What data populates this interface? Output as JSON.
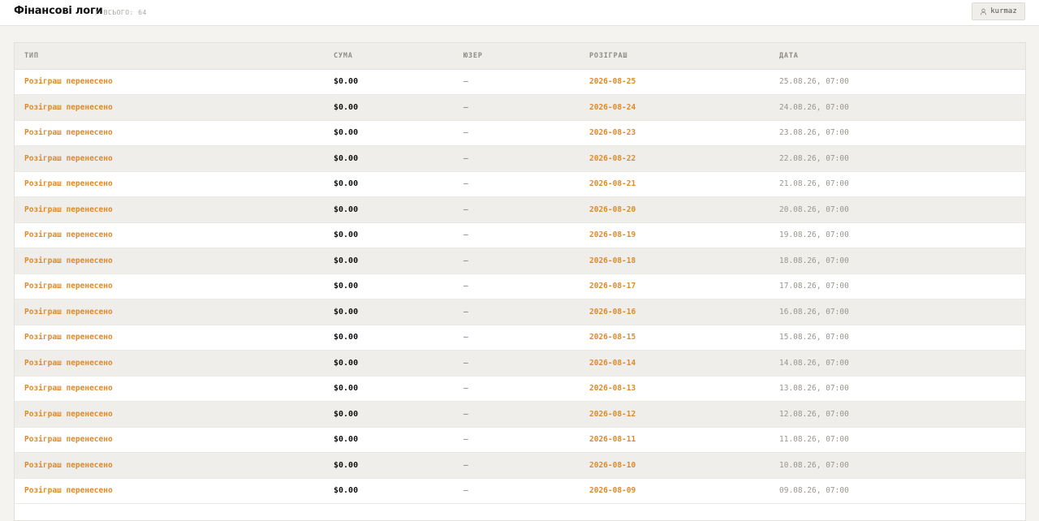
{
  "header": {
    "title": "Фінансові логи",
    "count_label": "/ ВСЬОГО: 64",
    "user_name": "kurmaz",
    "user_icon": "user-icon"
  },
  "table": {
    "columns": [
      "ТИП",
      "СУМА",
      "ЮЗЕР",
      "РОЗІГРАШ",
      "ДАТА"
    ],
    "rows": [
      {
        "type": "Розіграш перенесено",
        "amount": "$0.00",
        "user": "—",
        "draw": "2026-08-25",
        "date": "25.08.26, 07:00"
      },
      {
        "type": "Розіграш перенесено",
        "amount": "$0.00",
        "user": "—",
        "draw": "2026-08-24",
        "date": "24.08.26, 07:00"
      },
      {
        "type": "Розіграш перенесено",
        "amount": "$0.00",
        "user": "—",
        "draw": "2026-08-23",
        "date": "23.08.26, 07:00"
      },
      {
        "type": "Розіграш перенесено",
        "amount": "$0.00",
        "user": "—",
        "draw": "2026-08-22",
        "date": "22.08.26, 07:00"
      },
      {
        "type": "Розіграш перенесено",
        "amount": "$0.00",
        "user": "—",
        "draw": "2026-08-21",
        "date": "21.08.26, 07:00"
      },
      {
        "type": "Розіграш перенесено",
        "amount": "$0.00",
        "user": "—",
        "draw": "2026-08-20",
        "date": "20.08.26, 07:00"
      },
      {
        "type": "Розіграш перенесено",
        "amount": "$0.00",
        "user": "—",
        "draw": "2026-08-19",
        "date": "19.08.26, 07:00"
      },
      {
        "type": "Розіграш перенесено",
        "amount": "$0.00",
        "user": "—",
        "draw": "2026-08-18",
        "date": "18.08.26, 07:00"
      },
      {
        "type": "Розіграш перенесено",
        "amount": "$0.00",
        "user": "—",
        "draw": "2026-08-17",
        "date": "17.08.26, 07:00"
      },
      {
        "type": "Розіграш перенесено",
        "amount": "$0.00",
        "user": "—",
        "draw": "2026-08-16",
        "date": "16.08.26, 07:00"
      },
      {
        "type": "Розіграш перенесено",
        "amount": "$0.00",
        "user": "—",
        "draw": "2026-08-15",
        "date": "15.08.26, 07:00"
      },
      {
        "type": "Розіграш перенесено",
        "amount": "$0.00",
        "user": "—",
        "draw": "2026-08-14",
        "date": "14.08.26, 07:00"
      },
      {
        "type": "Розіграш перенесено",
        "amount": "$0.00",
        "user": "—",
        "draw": "2026-08-13",
        "date": "13.08.26, 07:00"
      },
      {
        "type": "Розіграш перенесено",
        "amount": "$0.00",
        "user": "—",
        "draw": "2026-08-12",
        "date": "12.08.26, 07:00"
      },
      {
        "type": "Розіграш перенесено",
        "amount": "$0.00",
        "user": "—",
        "draw": "2026-08-11",
        "date": "11.08.26, 07:00"
      },
      {
        "type": "Розіграш перенесено",
        "amount": "$0.00",
        "user": "—",
        "draw": "2026-08-10",
        "date": "10.08.26, 07:00"
      },
      {
        "type": "Розіграш перенесено",
        "amount": "$0.00",
        "user": "—",
        "draw": "2026-08-09",
        "date": "09.08.26, 07:00"
      }
    ]
  },
  "colors": {
    "accent": "#dd8a2c",
    "background": "#f4f3ef",
    "row_alt": "#efeeea"
  }
}
